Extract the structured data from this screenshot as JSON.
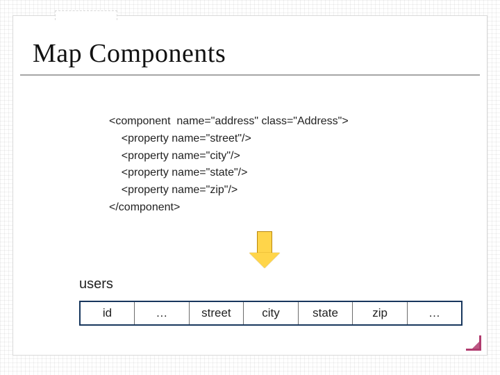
{
  "title": "Map Components",
  "code": {
    "lines": [
      "<component  name=\"address\" class=\"Address\">",
      "    <property name=\"street\"/>",
      "    <property name=\"city\"/>",
      "    <property name=\"state\"/>",
      "    <property name=\"zip\"/>",
      "</component>"
    ]
  },
  "table": {
    "name": "users",
    "columns": [
      "id",
      "…",
      "street",
      "city",
      "state",
      "zip",
      "…"
    ]
  }
}
